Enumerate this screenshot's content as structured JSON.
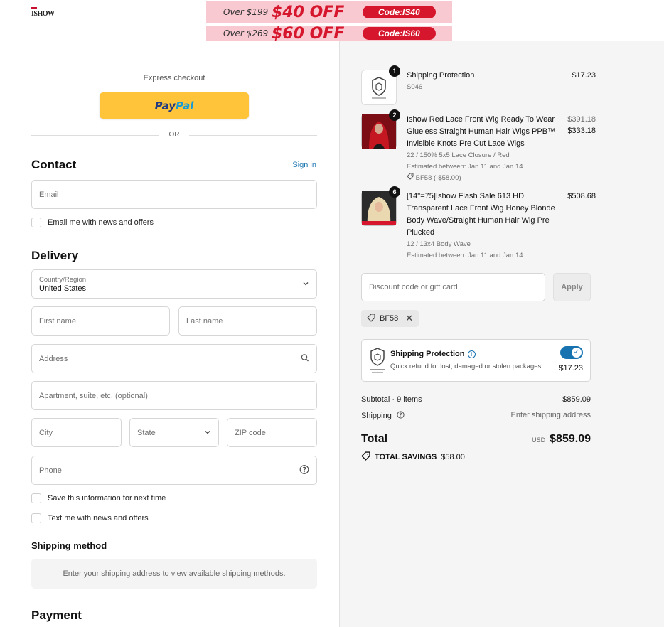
{
  "header": {
    "logo": "ISHOW",
    "promos": [
      {
        "over": "Over $199",
        "off": "$40 OFF",
        "code": "Code:IS40"
      },
      {
        "over": "Over $269",
        "off": "$60 OFF",
        "code": "Code:IS60"
      }
    ]
  },
  "checkout": {
    "express_label": "Express checkout",
    "paypal_a": "Pay",
    "paypal_b": "Pal",
    "or": "OR",
    "contact_title": "Contact",
    "sign_in": "Sign in",
    "email_placeholder": "Email",
    "email_news": "Email me with news and offers",
    "delivery_title": "Delivery",
    "country_label": "Country/Region",
    "country_value": "United States",
    "first_name": "First name",
    "last_name": "Last name",
    "address": "Address",
    "apartment": "Apartment, suite, etc. (optional)",
    "city": "City",
    "state": "State",
    "zip": "ZIP code",
    "phone": "Phone",
    "save_info": "Save this information for next time",
    "text_news": "Text me with news and offers",
    "shipping_method_title": "Shipping method",
    "shipping_method_msg": "Enter your shipping address to view available shipping methods.",
    "payment_title": "Payment"
  },
  "summary": {
    "items": [
      {
        "qty": "1",
        "name": "Shipping Protection",
        "meta": [
          "S046"
        ],
        "price": "$17.23",
        "compare_price": "",
        "discount": ""
      },
      {
        "qty": "2",
        "name": "Ishow Red Lace Front Wig Ready To Wear Glueless Straight Human Hair Wigs PPB™ Invisible Knots Pre Cut Lace Wigs",
        "meta": [
          "22 / 150% 5x5 Lace Closure / Red",
          "Estimated between: Jan 11 and Jan 14"
        ],
        "discount": "BF58 (-$58.00)",
        "compare_price": "$391.18",
        "price": "$333.18"
      },
      {
        "qty": "6",
        "name": "[14\"=75]Ishow Flash Sale 613 HD Transparent Lace Front Wig Honey Blonde Body Wave/Straight Human Hair Wig Pre Plucked",
        "meta": [
          "12 / 13x4 Body Wave",
          "Estimated between: Jan 11 and Jan 14"
        ],
        "price": "$508.68",
        "compare_price": "",
        "discount": ""
      }
    ],
    "discount_placeholder": "Discount code or gift card",
    "apply": "Apply",
    "applied_code": "BF58",
    "protection": {
      "title": "Shipping Protection",
      "desc": "Quick refund for lost, damaged or stolen packages.",
      "price": "$17.23",
      "enabled": true
    },
    "subtotal_label": "Subtotal · 9 items",
    "subtotal_value": "$859.09",
    "shipping_label": "Shipping",
    "shipping_value": "Enter shipping address",
    "total_label": "Total",
    "currency": "USD",
    "total_value": "$859.09",
    "savings_label": "TOTAL SAVINGS",
    "savings_value": "$58.00"
  },
  "colors": {
    "accent": "#1773b0",
    "paypal_yellow": "#ffc439",
    "promo_red": "#d6162c",
    "promo_pink": "#f9c9d1"
  }
}
